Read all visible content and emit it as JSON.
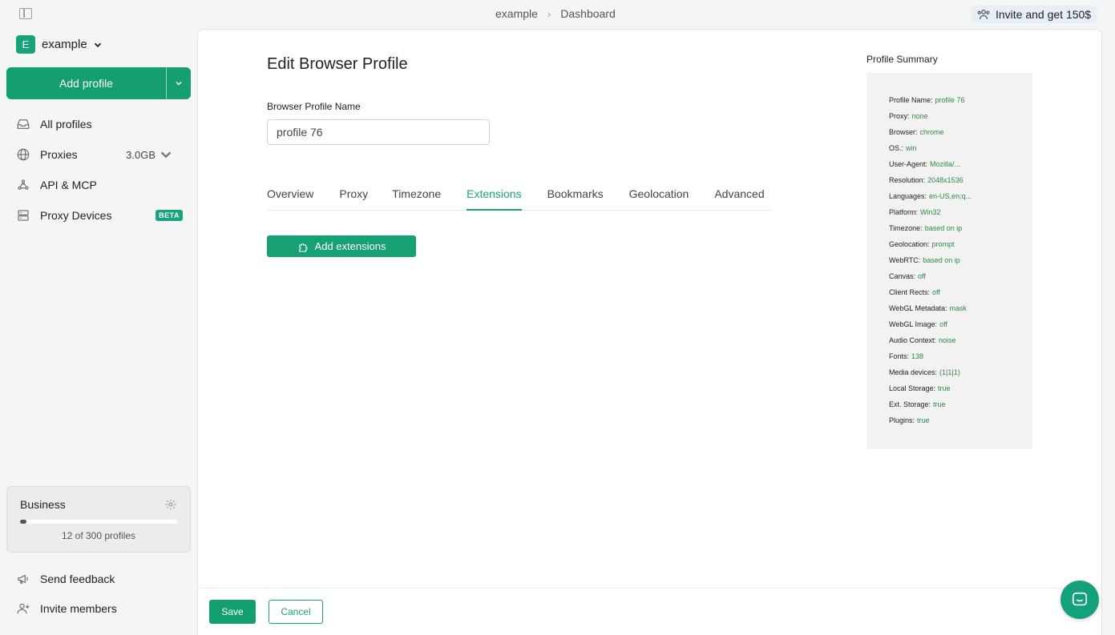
{
  "topbar": {
    "breadcrumb": [
      "example",
      "Dashboard"
    ],
    "invite_label": "Invite and get 150$"
  },
  "workspace": {
    "initial": "E",
    "name": "example"
  },
  "sidebar": {
    "add_profile_label": "Add profile",
    "items": [
      {
        "label": "All profiles",
        "icon": "inbox-icon"
      },
      {
        "label": "Proxies",
        "icon": "globe-icon",
        "meta": "3.0GB"
      },
      {
        "label": "API & MCP",
        "icon": "api-icon"
      },
      {
        "label": "Proxy Devices",
        "icon": "server-icon",
        "badge": "BETA"
      }
    ],
    "plan": {
      "name": "Business",
      "usage_text": "12 of 300 profiles",
      "used": 12,
      "limit": 300
    },
    "bottom_items": [
      {
        "label": "Send feedback",
        "icon": "megaphone-icon"
      },
      {
        "label": "Invite members",
        "icon": "user-plus-icon"
      }
    ]
  },
  "editor": {
    "title": "Edit Browser Profile",
    "name_label": "Browser Profile Name",
    "name_value": "profile 76",
    "tabs": [
      "Overview",
      "Proxy",
      "Timezone",
      "Extensions",
      "Bookmarks",
      "Geolocation",
      "Advanced"
    ],
    "active_tab": "Extensions",
    "add_extensions_label": "Add extensions"
  },
  "summary": {
    "title": "Profile Summary",
    "rows": [
      {
        "key": "Profile Name:",
        "value": "profile 76"
      },
      {
        "key": "Proxy:",
        "value": "none"
      },
      {
        "key": "Browser:",
        "value": "chrome"
      },
      {
        "key": "OS.:",
        "value": "win"
      },
      {
        "key": "User-Agent:",
        "value": "Mozilla/..."
      },
      {
        "key": "Resolution:",
        "value": "2048x1536"
      },
      {
        "key": "Languages:",
        "value": "en-US,en;q..."
      },
      {
        "key": "Platform:",
        "value": "Win32"
      },
      {
        "key": "Timezone:",
        "value": "based on ip"
      },
      {
        "key": "Geolocation:",
        "value": "prompt"
      },
      {
        "key": "WebRTC:",
        "value": "based on ip"
      },
      {
        "key": "Canvas:",
        "value": "off"
      },
      {
        "key": "Client Rects:",
        "value": "off"
      },
      {
        "key": "WebGL Metadata:",
        "value": "mask"
      },
      {
        "key": "WebGL Image:",
        "value": "off"
      },
      {
        "key": "Audio Context:",
        "value": "noise"
      },
      {
        "key": "Fonts:",
        "value": "138"
      },
      {
        "key": "Media devices:",
        "value": "(1|1|1)"
      },
      {
        "key": "Local Storage:",
        "value": "true"
      },
      {
        "key": "Ext. Storage:",
        "value": "true"
      },
      {
        "key": "Plugins:",
        "value": "true"
      }
    ]
  },
  "footer": {
    "save_label": "Save",
    "cancel_label": "Cancel"
  },
  "colors": {
    "accent": "#16a074",
    "summary_value": "#2f8a3e"
  }
}
